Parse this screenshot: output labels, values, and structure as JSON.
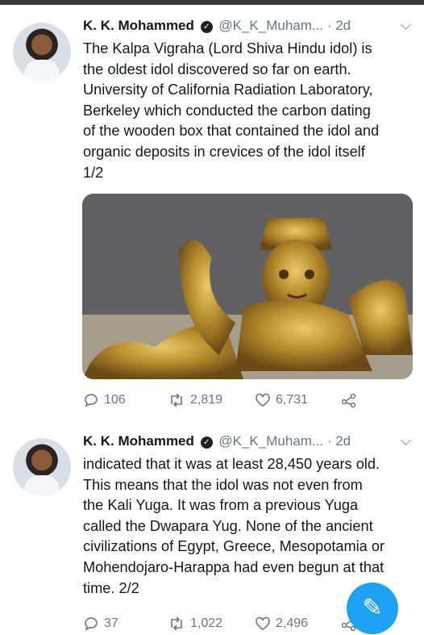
{
  "tweets": [
    {
      "name": "K. K. Mohammed",
      "handle": "@K_K_Muham...",
      "separator": "·",
      "time": "2d",
      "text": "The Kalpa Vigraha (Lord Shiva Hindu idol) is\nthe oldest idol discovered so far on earth.\nUniversity of California Radiation Laboratory,\nBerkeley which conducted the carbon dating\nof the wooden box that contained the idol and\norganic deposits in crevices of the idol itself\n1/2",
      "replies": "106",
      "retweets": "2,819",
      "likes": "6,731"
    },
    {
      "name": "K. K. Mohammed",
      "handle": "@K_K_Muham...",
      "separator": "·",
      "time": "2d",
      "text": "indicated that it was at least 28,450 years old.\nThis means that the idol was not even from\nthe Kali Yuga. It was from a previous Yuga\ncalled the Dwapara Yug. None of the ancient\ncivilizations of Egypt, Greece, Mesopotamia or\nMohendojaro-Harappa had even begun at that\ntime. 2/2",
      "replies": "37",
      "retweets": "1,022",
      "likes": "2,496"
    }
  ],
  "icons": {
    "verified": "verified-badge-icon",
    "reply": "reply-icon",
    "retweet": "retweet-icon",
    "like": "heart-icon",
    "share": "share-icon",
    "compose": "compose-tweet-icon"
  },
  "colors": {
    "accent": "#1da1f2",
    "secondary_text": "#657786"
  }
}
